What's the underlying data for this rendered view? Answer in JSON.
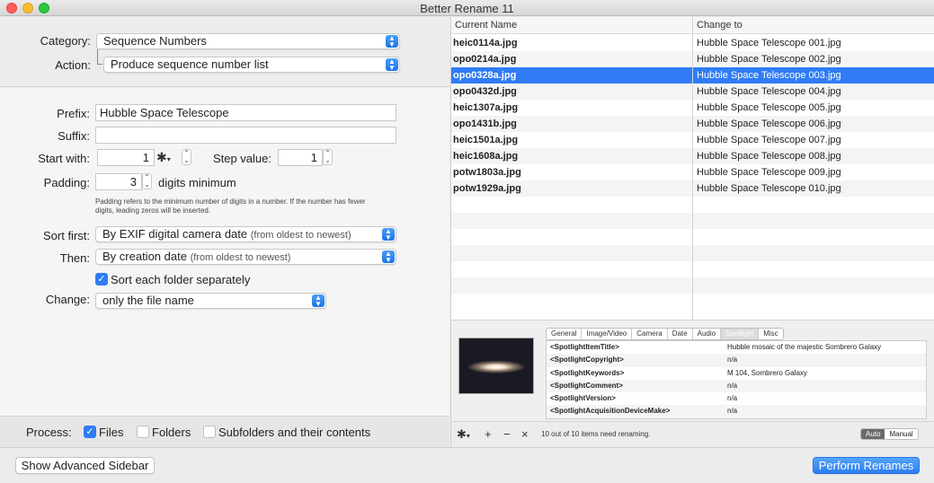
{
  "window": {
    "title": "Better Rename 11"
  },
  "top": {
    "category_label": "Category:",
    "category_value": "Sequence Numbers",
    "action_label": "Action:",
    "action_value": "Produce sequence number list"
  },
  "form": {
    "prefix_label": "Prefix:",
    "prefix_value": "Hubble Space Telescope",
    "suffix_label": "Suffix:",
    "suffix_value": "",
    "start_label": "Start with:",
    "start_value": "1",
    "step_label": "Step value:",
    "step_value": "1",
    "padding_label": "Padding:",
    "padding_value": "3",
    "padding_suffix": "digits minimum",
    "padding_note_1": "Padding refers to the minimum number of digits in a number. If the number has fewer",
    "padding_note_2": "digits, leading zeros will be inserted.",
    "sort_first_label": "Sort first:",
    "sort_first_value": "By EXIF digital camera date",
    "sort_first_sub": "(from oldest to newest)",
    "then_label": "Then:",
    "then_value": "By creation date",
    "then_sub": "(from oldest to newest)",
    "sort_folder_label": "Sort each folder separately",
    "change_label": "Change:",
    "change_value": "only the file name"
  },
  "process": {
    "label": "Process:",
    "files": "Files",
    "folders": "Folders",
    "subfolders": "Subfolders and their contents"
  },
  "table": {
    "col_current": "Current Name",
    "col_change": "Change to",
    "rows": [
      {
        "current": "heic0114a.jpg",
        "new": "Hubble Space Telescope 001.jpg"
      },
      {
        "current": "opo0214a.jpg",
        "new": "Hubble Space Telescope 002.jpg"
      },
      {
        "current": "opo0328a.jpg",
        "new": "Hubble Space Telescope 003.jpg"
      },
      {
        "current": "opo0432d.jpg",
        "new": "Hubble Space Telescope 004.jpg"
      },
      {
        "current": "heic1307a.jpg",
        "new": "Hubble Space Telescope 005.jpg"
      },
      {
        "current": "opo1431b.jpg",
        "new": "Hubble Space Telescope 006.jpg"
      },
      {
        "current": "heic1501a.jpg",
        "new": "Hubble Space Telescope 007.jpg"
      },
      {
        "current": "heic1608a.jpg",
        "new": "Hubble Space Telescope 008.jpg"
      },
      {
        "current": "potw1803a.jpg",
        "new": "Hubble Space Telescope 009.jpg"
      },
      {
        "current": "potw1929a.jpg",
        "new": "Hubble Space Telescope 010.jpg"
      }
    ]
  },
  "info": {
    "tabs": [
      "General",
      "Image/Video",
      "Camera",
      "Date",
      "Audio",
      "Spotlight",
      "Misc"
    ],
    "meta": [
      {
        "key": "<SpotlightItemTitle>",
        "value": "Hubble mosaic of the majestic Sombrero Galaxy"
      },
      {
        "key": "<SpotlightCopyright>",
        "value": "n/a"
      },
      {
        "key": "<SpotlightKeywords>",
        "value": "M 104, Sombrero Galaxy"
      },
      {
        "key": "<SpotlightComment>",
        "value": "n/a"
      },
      {
        "key": "<SpotlightVersion>",
        "value": "n/a"
      },
      {
        "key": "<SpotlightAcquisitionDeviceMake>",
        "value": "n/a"
      }
    ]
  },
  "footer": {
    "status": "10 out of 10 items need renaming.",
    "auto": "Auto",
    "manual": "Manual",
    "sidebar_button": "Show Advanced Sidebar",
    "perform_button": "Perform Renames"
  }
}
